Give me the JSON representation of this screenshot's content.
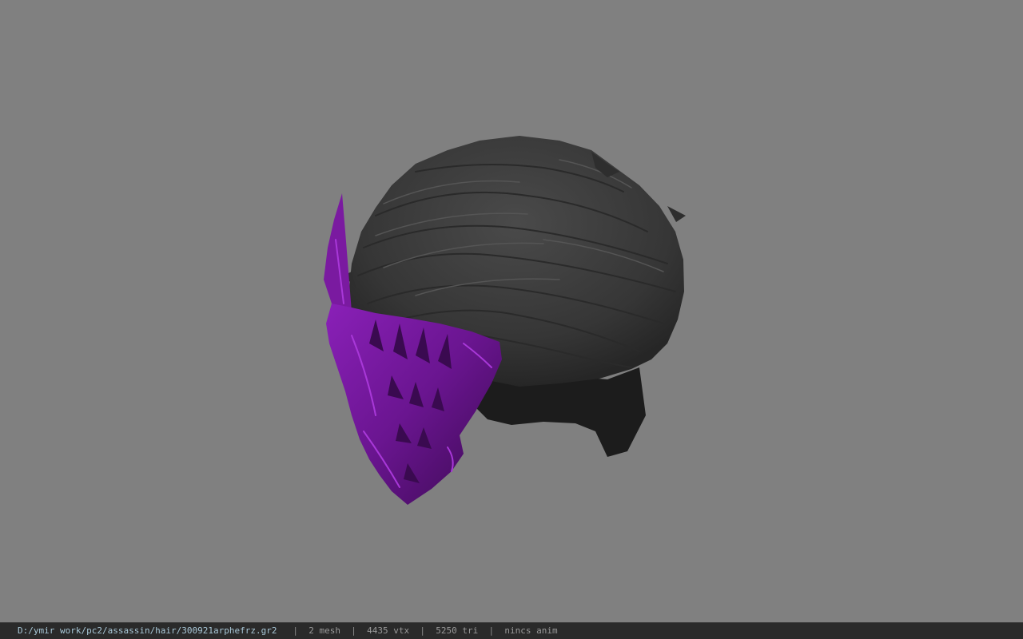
{
  "viewport": {
    "background_color": "#808080",
    "model": {
      "hair_color": "#3c3c3c",
      "hair_shadow_color": "#1e1e1e",
      "mask_color": "#7a1aa0",
      "mask_highlight_color": "#a030d0",
      "mask_shadow_color": "#3a0a50"
    }
  },
  "statusbar": {
    "file_path": "D:/ymir work/pc2/assassin/hair/300921arphefrz.gr2",
    "separator": "|",
    "mesh_count": "2 mesh",
    "vertex_count": "4435 vtx",
    "triangle_count": "5250 tri",
    "anim_status": "nincs anim"
  }
}
